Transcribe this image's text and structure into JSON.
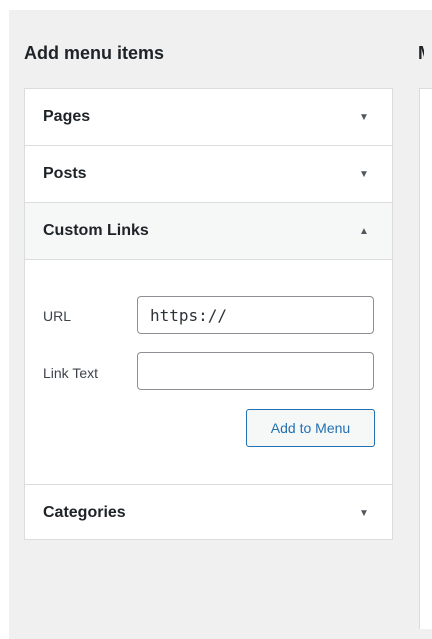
{
  "heading": "Add menu items",
  "heading_right": "M",
  "sections": [
    {
      "title": "Pages",
      "arrow": "▼"
    },
    {
      "title": "Posts",
      "arrow": "▼"
    },
    {
      "title": "Custom Links",
      "arrow": "▲"
    },
    {
      "title": "Categories",
      "arrow": "▼"
    }
  ],
  "custom_links": {
    "url_label": "URL",
    "url_value": "https://",
    "link_text_label": "Link Text",
    "link_text_value": "",
    "add_button": "Add to Menu"
  },
  "colors": {
    "accent": "#2271b1",
    "background": "#f0f0f1",
    "panel": "#ffffff",
    "border": "#dcdcde"
  }
}
